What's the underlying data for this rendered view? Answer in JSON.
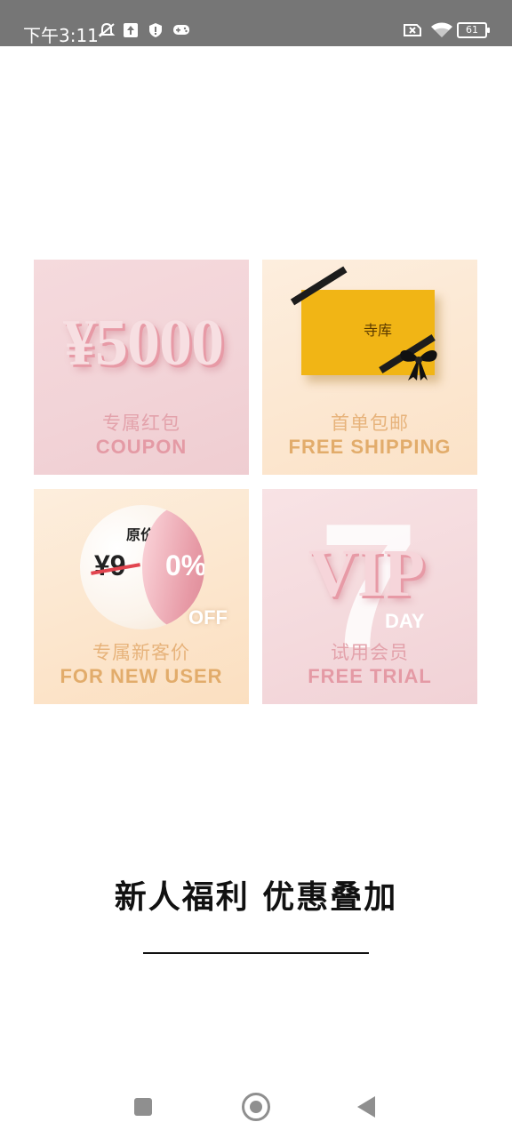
{
  "status_bar": {
    "time": "下午3:11",
    "battery": "61",
    "icons_left": [
      "mute-icon",
      "upload-icon",
      "shield-icon",
      "gamepad-icon"
    ],
    "icons_right": [
      "sim-x-icon",
      "wifi-icon",
      "battery-icon"
    ]
  },
  "tiles": [
    {
      "id": "coupon",
      "hero": "¥5000",
      "cn": "专属红包",
      "en": "COUPON"
    },
    {
      "id": "shipping",
      "box_logo": "寺库",
      "cn": "首单包邮",
      "en": "FREE SHIPPING"
    },
    {
      "id": "newuser",
      "orig_label": "原价",
      "price": "¥9",
      "percent": "0%",
      "off": "OFF",
      "cn": "专属新客价",
      "en": "FOR NEW USER"
    },
    {
      "id": "vip",
      "number": "7",
      "vip": "VIP",
      "day": "DAY",
      "cn": "试用会员",
      "en": "FREE TRIAL"
    }
  ],
  "headline": "新人福利 优惠叠加",
  "nav": [
    "recent-apps-button",
    "home-button",
    "back-button"
  ],
  "colors": {
    "status_bar": "#767676",
    "pink_text": "#e3a2ab",
    "gold_text": "#e7b37b",
    "gift_box": "#f1b515"
  }
}
